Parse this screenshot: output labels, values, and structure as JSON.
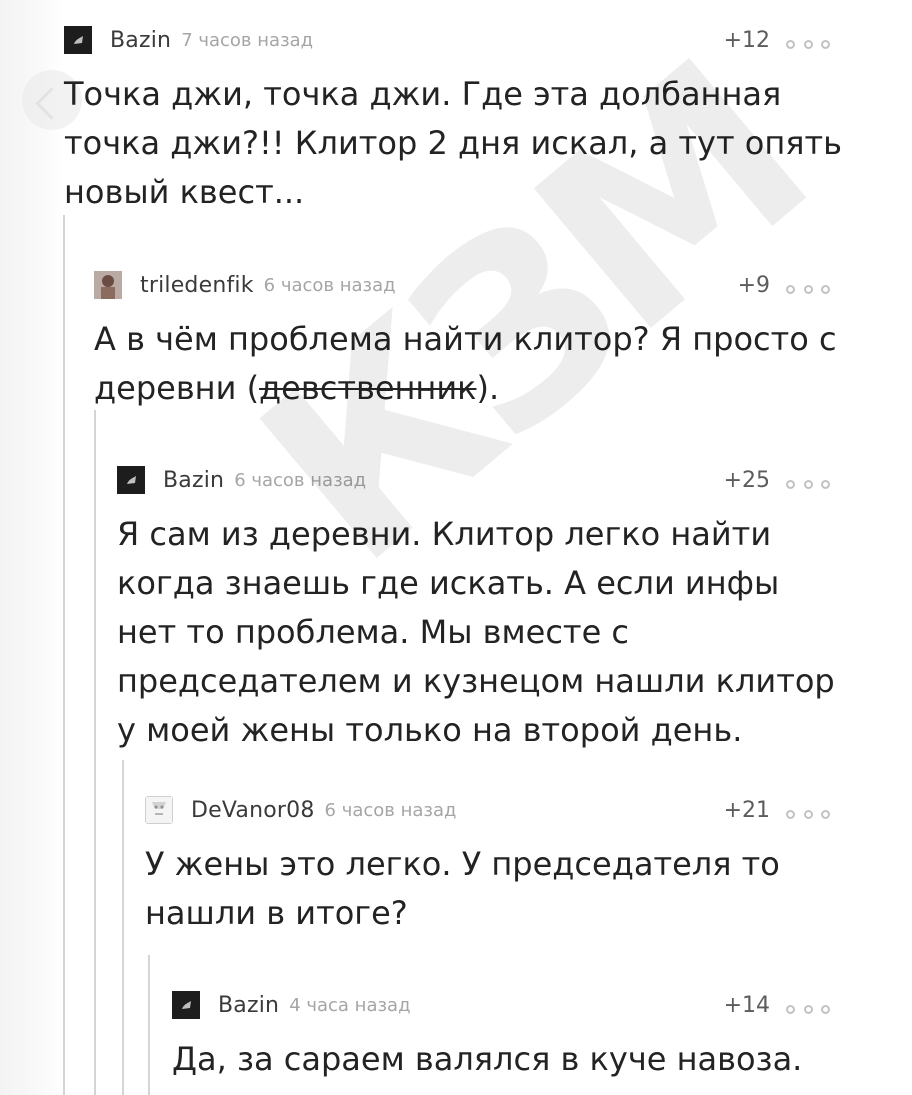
{
  "watermark": "КЗМ",
  "comments": [
    {
      "username": "Bazin",
      "timestamp": "7 часов назад",
      "rating": "+12",
      "text": "Точка джи, точка джи. Где эта долбанная точка джи?!! Клитор 2 дня искал, а тут опять новый квест..."
    },
    {
      "username": "triledenfik",
      "timestamp": "6 часов назад",
      "rating": "+9",
      "text_prefix": "А в чём проблема найти клитор? Я просто с деревни (",
      "text_strike": "девственник",
      "text_suffix": ")."
    },
    {
      "username": "Bazin",
      "timestamp": "6 часов назад",
      "rating": "+25",
      "text": "Я сам из деревни. Клитор легко найти когда знаешь где искать. А если инфы нет то проблема. Мы вместе с председателем и кузнецом нашли клитор у моей жены только на второй день."
    },
    {
      "username": "DeVanor08",
      "timestamp": "6 часов назад",
      "rating": "+21",
      "text": "У жены это легко. У председателя то нашли в итоге?"
    },
    {
      "username": "Bazin",
      "timestamp": "4 часа назад",
      "rating": "+14",
      "text": "Да, за сараем валялся в куче навоза."
    }
  ]
}
